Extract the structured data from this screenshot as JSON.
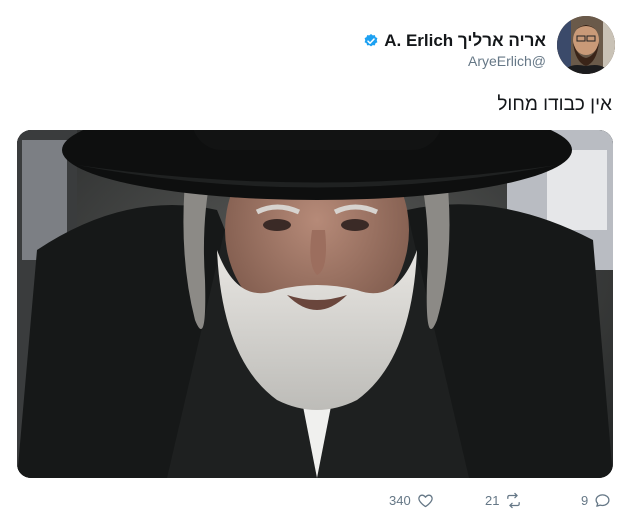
{
  "author": {
    "display_name": "A. Erlich אריה ארליך",
    "handle": "AryeErlich@",
    "verified_icon": "verified-badge-icon",
    "avatar": "avatar-photo"
  },
  "tweet": {
    "text": "אין כבודו מחול",
    "media_description": "photo"
  },
  "actions": {
    "likes": "340",
    "retweets": "21",
    "replies": "9"
  },
  "colors": {
    "verified": "#1da1f2",
    "secondary_text": "#657786",
    "primary_text": "#14171a"
  }
}
